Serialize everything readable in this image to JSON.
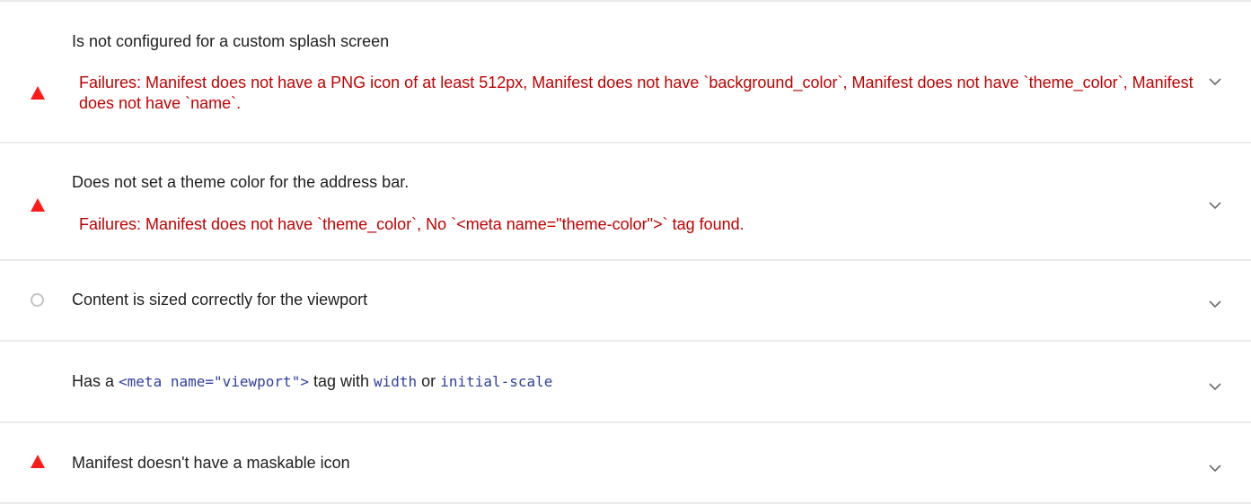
{
  "colors": {
    "fail": "#ff1a1a",
    "failure_text": "#c00000",
    "neutral": "#c4c4c4",
    "code": "#303f9f",
    "divider": "#ebebeb"
  },
  "audits": [
    {
      "status": "fail",
      "status_icon": "warning-triangle-icon",
      "title": "Is not configured for a custom splash screen",
      "failure_text": "Failures: Manifest does not have a PNG icon of at least 512px, Manifest does not have `background_color`, Manifest does not have `theme_color`, Manifest does not have `name`.",
      "expand_icon": "chevron-down-icon"
    },
    {
      "status": "fail",
      "status_icon": "warning-triangle-icon",
      "title": "Does not set a theme color for the address bar.",
      "failure_text": "Failures: Manifest does not have `theme_color`, No `<meta name=\"theme-color\">` tag found.",
      "expand_icon": "chevron-down-icon"
    },
    {
      "status": "neutral",
      "status_icon": "info-circle-icon",
      "title": "Content is sized correctly for the viewport",
      "expand_icon": "chevron-down-icon"
    },
    {
      "status": "none",
      "title_parts": {
        "prefix": "Has a ",
        "code_meta": "<meta name=\"viewport\">",
        "middle": " tag with ",
        "code_width": "width",
        "or": " or ",
        "code_scale": "initial-scale"
      },
      "expand_icon": "chevron-down-icon"
    },
    {
      "status": "fail",
      "status_icon": "warning-triangle-icon",
      "title": "Manifest doesn't have a maskable icon",
      "expand_icon": "chevron-down-icon"
    }
  ]
}
